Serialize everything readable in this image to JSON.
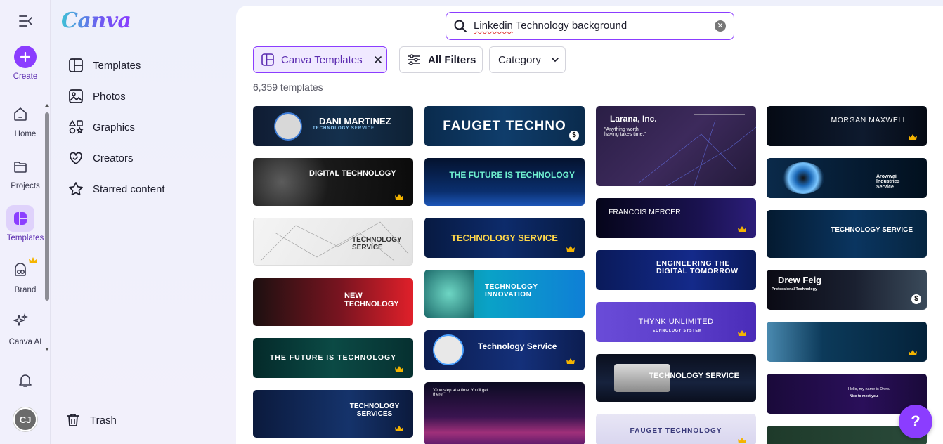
{
  "colors": {
    "accent": "#8b3dff",
    "active_bg": "#dfd2fb",
    "crown": "#f5b400"
  },
  "rail": {
    "create_label": "Create",
    "items": [
      {
        "label": "Home",
        "icon": "home-icon"
      },
      {
        "label": "Projects",
        "icon": "folder-icon"
      },
      {
        "label": "Templates",
        "icon": "templates-icon"
      },
      {
        "label": "Brand",
        "icon": "brand-icon"
      },
      {
        "label": "Canva AI",
        "icon": "sparkle-icon"
      }
    ],
    "avatar_initials": "CJ"
  },
  "panel": {
    "logo": "Canva",
    "items": [
      {
        "label": "Templates",
        "icon": "template-layout-icon"
      },
      {
        "label": "Photos",
        "icon": "photo-icon"
      },
      {
        "label": "Graphics",
        "icon": "shapes-icon"
      },
      {
        "label": "Creators",
        "icon": "heart-hands-icon"
      },
      {
        "label": "Starred content",
        "icon": "star-icon"
      }
    ],
    "trash_label": "Trash"
  },
  "search": {
    "query_word1": "Linkedin",
    "query_rest": " Technology background"
  },
  "filters": {
    "active_chip": "Canva Templates",
    "all_filters": "All Filters",
    "category": "Category"
  },
  "results_count": "6,359 templates",
  "cards": {
    "c0": [
      "DANI MARTINEZ",
      "FAUGET TECHNO",
      "Larana, Inc.",
      "MORGAN MAXWELL"
    ],
    "c1": [
      "DIGITAL TECHNOLOGY",
      "THE FUTURE IS TECHNOLOGY",
      "FRANCOIS MERCER",
      "Arowwai Industries Service"
    ],
    "c2": [
      "TECHNOLOGY SERVICE",
      "TECHNOLOGY SERVICE",
      "ENGINEERING THE DIGITAL TOMORROW",
      "TECHNOLOGY SERVICE"
    ],
    "c3": [
      "NEW TECHNOLOGY",
      "TECHNOLOGY INNOVATION",
      "THYNK UNLIMITED",
      "Drew Feig"
    ],
    "c4": [
      "THE FUTURE IS TECHNOLOGY",
      "Technology Service",
      "TECHNOLOGY SERVICE",
      ""
    ],
    "c5": [
      "TECHNOLOGY SERVICES",
      "",
      "FAUGET TECHNOLOGY",
      "Hello, my name is Drew."
    ]
  },
  "card_subtexts": {
    "dani": "TECHNOLOGY SERVICE",
    "larana_quote": "\"Anything worth having takes time.\"",
    "drew_sub": "Professional Technology",
    "thynk_sub": "TECHNOLOGY SYSTEM",
    "one_step": "\"One step at a time. You'll get there.\"",
    "drew_hello_sub": "Nice to meet you."
  },
  "help_label": "?"
}
